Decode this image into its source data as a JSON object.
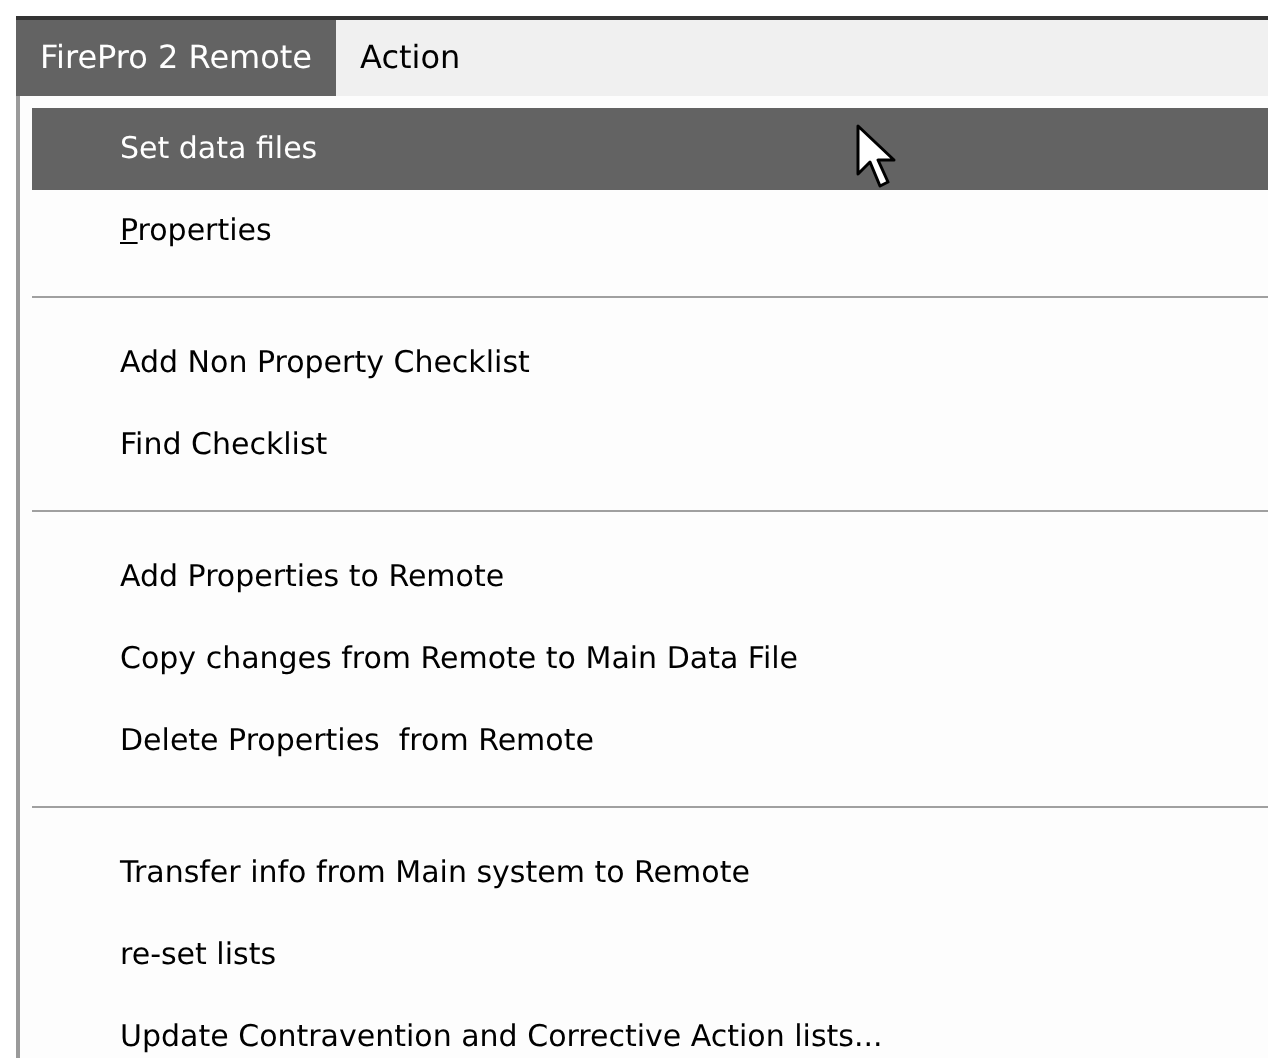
{
  "menubar": [
    {
      "label": "FirePro 2 Remote",
      "selected": true
    },
    {
      "label": "Action",
      "selected": false
    }
  ],
  "menu": {
    "groups": [
      [
        {
          "label": "Set data files",
          "selected": true,
          "mnemonic_underlined": false
        },
        {
          "label": "Properties",
          "selected": false,
          "mnemonic_underlined": true
        }
      ],
      [
        {
          "label": "Add Non Property Checklist",
          "selected": false,
          "mnemonic_underlined": false
        },
        {
          "label": "Find Checklist",
          "selected": false,
          "mnemonic_underlined": false
        }
      ],
      [
        {
          "label": "Add Properties to Remote",
          "selected": false,
          "mnemonic_underlined": false
        },
        {
          "label": "Copy changes from Remote to Main Data File",
          "selected": false,
          "mnemonic_underlined": false
        },
        {
          "label": "Delete Properties  from Remote",
          "selected": false,
          "mnemonic_underlined": false
        }
      ],
      [
        {
          "label": "Transfer info from Main system to Remote",
          "selected": false,
          "mnemonic_underlined": false
        },
        {
          "label": "re-set lists",
          "selected": false,
          "mnemonic_underlined": false
        },
        {
          "label": "Update Contravention and Corrective Action lists...",
          "selected": false,
          "mnemonic_underlined": false
        }
      ]
    ]
  }
}
